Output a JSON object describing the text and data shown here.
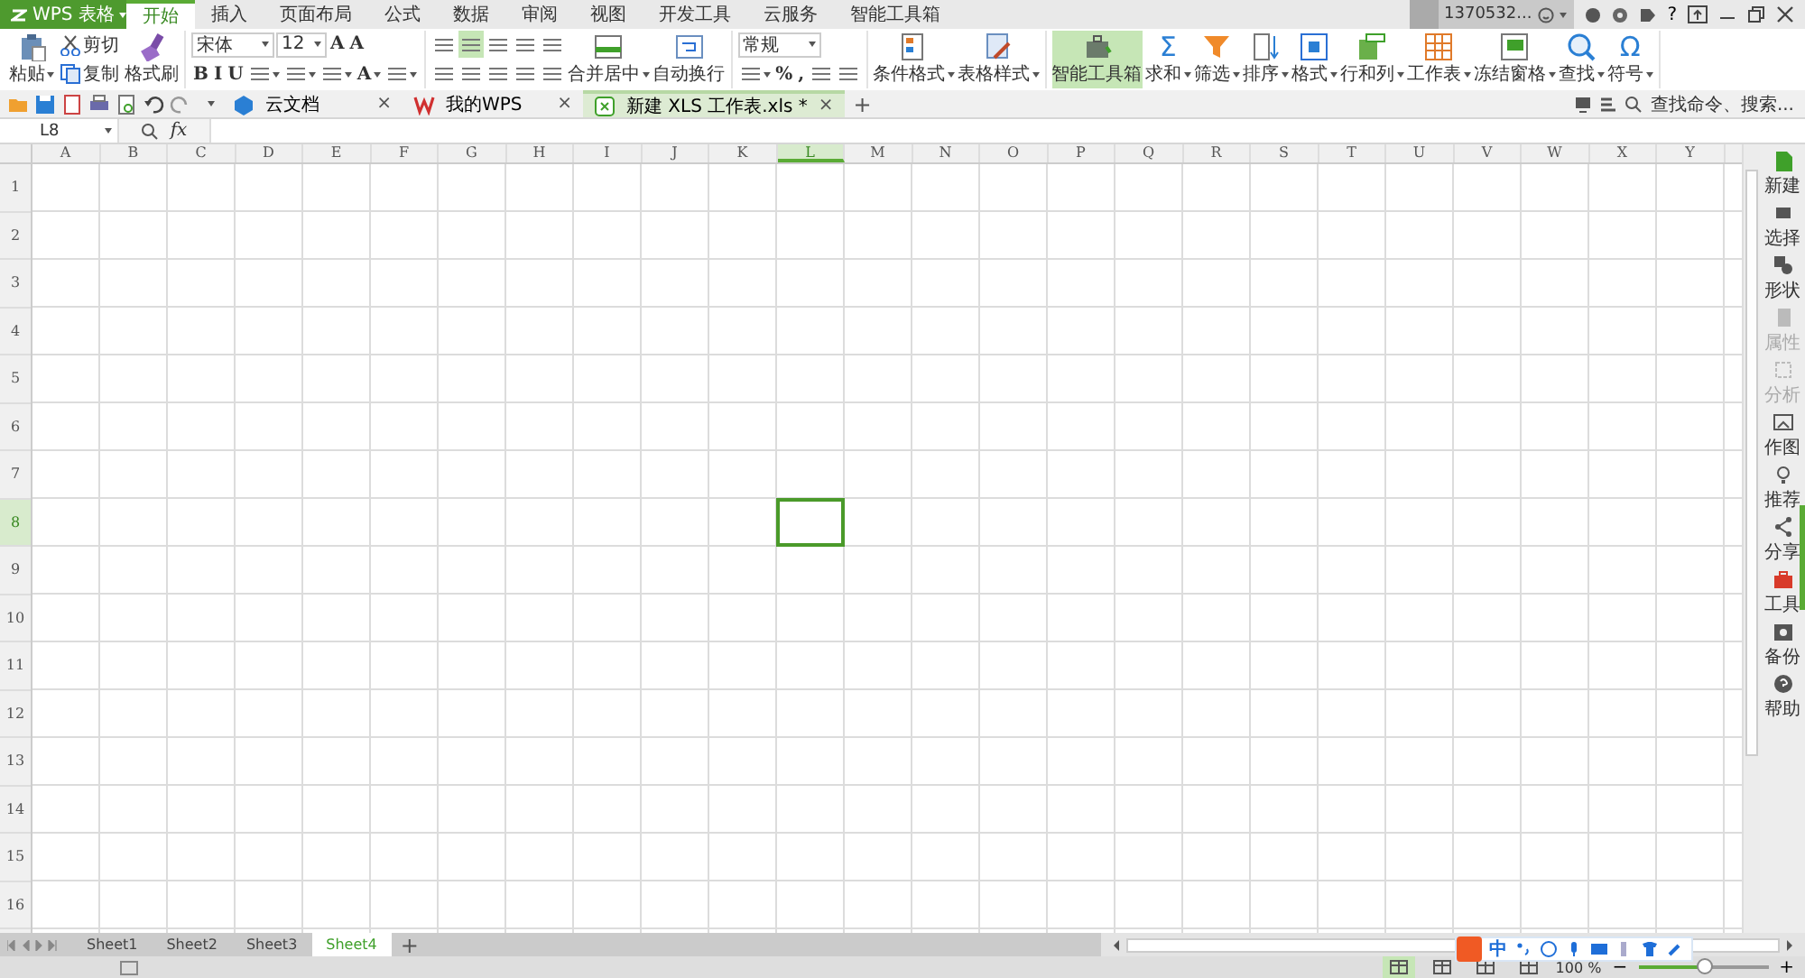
{
  "app_button": {
    "label": "WPS 表格",
    "dropdown": true
  },
  "menu_tabs": [
    {
      "label": "开始",
      "selected": true
    },
    {
      "label": "插入",
      "selected": false
    },
    {
      "label": "页面布局",
      "selected": false
    },
    {
      "label": "公式",
      "selected": false
    },
    {
      "label": "数据",
      "selected": false
    },
    {
      "label": "审阅",
      "selected": false
    },
    {
      "label": "视图",
      "selected": false
    },
    {
      "label": "开发工具",
      "selected": false
    },
    {
      "label": "云服务",
      "selected": false
    },
    {
      "label": "智能工具箱",
      "selected": false
    }
  ],
  "account": {
    "user": "1370532...",
    "help": "?"
  },
  "ribbon": {
    "groups": [
      {
        "items": [
          {
            "kind": "large",
            "label": "粘贴",
            "dropdown": true
          },
          {
            "kind": "stack",
            "lines": [
              {
                "tools": [
                  {
                    "kind": "tool",
                    "label": "剪切"
                  }
                ]
              },
              {
                "tools": [
                  {
                    "kind": "tool",
                    "label": "复制"
                  }
                ]
              }
            ]
          },
          {
            "kind": "large",
            "label": "格式刷"
          }
        ]
      },
      {
        "items": [
          {
            "kind": "stack",
            "lines": [
              {
                "tools": [
                  {
                    "kind": "field",
                    "value": "宋体"
                  },
                  {
                    "kind": "field",
                    "value": "12"
                  },
                  {
                    "kind": "tool",
                    "text": "A"
                  },
                  {
                    "kind": "tool",
                    "text": "A"
                  }
                ]
              },
              {
                "tools": [
                  {
                    "kind": "tool",
                    "text": "B"
                  },
                  {
                    "kind": "tool",
                    "text": "I"
                  },
                  {
                    "kind": "tool",
                    "text": "U"
                  },
                  {
                    "kind": "tool",
                    "dropdown": true
                  },
                  {
                    "kind": "tool",
                    "dropdown": true
                  },
                  {
                    "kind": "tool",
                    "dropdown": true
                  },
                  {
                    "kind": "tool",
                    "text": "A",
                    "dropdown": true
                  },
                  {
                    "kind": "tool",
                    "dropdown": true
                  }
                ]
              }
            ]
          }
        ]
      },
      {
        "items": [
          {
            "kind": "stack",
            "lines": [
              {
                "tools": [
                  {
                    "kind": "tool",
                    "selected": false
                  },
                  {
                    "kind": "tool",
                    "selected": true
                  },
                  {
                    "kind": "tool",
                    "selected": false
                  },
                  {
                    "kind": "tool",
                    "selected": false
                  },
                  {
                    "kind": "tool",
                    "selected": false
                  }
                ]
              },
              {
                "tools": [
                  {
                    "kind": "tool",
                    "selected": false
                  },
                  {
                    "kind": "tool",
                    "selected": false
                  },
                  {
                    "kind": "tool",
                    "selected": false
                  },
                  {
                    "kind": "tool",
                    "selected": false
                  },
                  {
                    "kind": "tool",
                    "selected": false
                  }
                ]
              }
            ]
          },
          {
            "kind": "large",
            "label": "合并居中",
            "dropdown": true
          },
          {
            "kind": "large",
            "label": "自动换行"
          }
        ]
      },
      {
        "items": [
          {
            "kind": "stack",
            "lines": [
              {
                "tools": [
                  {
                    "kind": "field",
                    "value": "常规"
                  }
                ]
              },
              {
                "tools": [
                  {
                    "kind": "tool",
                    "dropdown": true
                  },
                  {
                    "kind": "tool",
                    "text": "%"
                  },
                  {
                    "kind": "tool",
                    "text": ","
                  },
                  {
                    "kind": "tool"
                  },
                  {
                    "kind": "tool"
                  }
                ]
              }
            ]
          }
        ]
      },
      {
        "items": [
          {
            "kind": "large",
            "label": "条件格式",
            "dropdown": true
          },
          {
            "kind": "large",
            "label": "表格样式",
            "dropdown": true
          }
        ]
      },
      {
        "items": [
          {
            "kind": "large",
            "label": "智能工具箱",
            "selected": true
          },
          {
            "kind": "large",
            "label": "求和",
            "text": "Σ",
            "dropdown": true
          },
          {
            "kind": "large",
            "label": "筛选",
            "dropdown": true
          },
          {
            "kind": "large",
            "label": "排序",
            "dropdown": true
          },
          {
            "kind": "large",
            "label": "格式",
            "dropdown": true
          },
          {
            "kind": "large",
            "label": "行和列",
            "dropdown": true
          },
          {
            "kind": "large",
            "label": "工作表",
            "dropdown": true
          },
          {
            "kind": "large",
            "label": "冻结窗格",
            "dropdown": true
          },
          {
            "kind": "large",
            "label": "查找",
            "dropdown": true
          },
          {
            "kind": "large",
            "label": "符号",
            "text": "Ω",
            "dropdown": true
          }
        ]
      }
    ]
  },
  "doc_tabs": [
    {
      "label": "云文档",
      "close": "×",
      "selected": false
    },
    {
      "label": "我的WPS",
      "close": "×",
      "selected": false
    },
    {
      "label": "新建 XLS 工作表.xls *",
      "close": "×",
      "selected": true
    }
  ],
  "new_tab": "+",
  "command_search": {
    "placeholder": "查找命令、搜索..."
  },
  "formula_bar": {
    "name_box": "L8",
    "fx": "fx"
  },
  "sheet": {
    "columns": [
      {
        "label": "A",
        "selected": false
      },
      {
        "label": "B",
        "selected": false
      },
      {
        "label": "C",
        "selected": false
      },
      {
        "label": "D",
        "selected": false
      },
      {
        "label": "E",
        "selected": false
      },
      {
        "label": "F",
        "selected": false
      },
      {
        "label": "G",
        "selected": false
      },
      {
        "label": "H",
        "selected": false
      },
      {
        "label": "I",
        "selected": false
      },
      {
        "label": "J",
        "selected": false
      },
      {
        "label": "K",
        "selected": false
      },
      {
        "label": "L",
        "selected": true
      },
      {
        "label": "M",
        "selected": false
      },
      {
        "label": "N",
        "selected": false
      },
      {
        "label": "O",
        "selected": false
      },
      {
        "label": "P",
        "selected": false
      },
      {
        "label": "Q",
        "selected": false
      },
      {
        "label": "R",
        "selected": false
      },
      {
        "label": "S",
        "selected": false
      },
      {
        "label": "T",
        "selected": false
      },
      {
        "label": "U",
        "selected": false
      },
      {
        "label": "V",
        "selected": false
      },
      {
        "label": "W",
        "selected": false
      },
      {
        "label": "X",
        "selected": false
      },
      {
        "label": "Y",
        "selected": false
      }
    ],
    "rows": [
      {
        "label": "1",
        "selected": false
      },
      {
        "label": "2",
        "selected": false
      },
      {
        "label": "3",
        "selected": false
      },
      {
        "label": "4",
        "selected": false
      },
      {
        "label": "5",
        "selected": false
      },
      {
        "label": "6",
        "selected": false
      },
      {
        "label": "7",
        "selected": false
      },
      {
        "label": "8",
        "selected": true
      },
      {
        "label": "9",
        "selected": false
      },
      {
        "label": "10",
        "selected": false
      },
      {
        "label": "11",
        "selected": false
      },
      {
        "label": "12",
        "selected": false
      },
      {
        "label": "13",
        "selected": false
      },
      {
        "label": "14",
        "selected": false
      },
      {
        "label": "15",
        "selected": false
      },
      {
        "label": "16",
        "selected": false
      }
    ]
  },
  "sheet_tabs": [
    {
      "label": "Sheet1",
      "selected": false
    },
    {
      "label": "Sheet2",
      "selected": false
    },
    {
      "label": "Sheet3",
      "selected": false
    },
    {
      "label": "Sheet4",
      "selected": true
    }
  ],
  "add_sheet": "+",
  "sidebar": [
    {
      "label": "新建",
      "disabled": false
    },
    {
      "label": "选择",
      "disabled": false
    },
    {
      "label": "形状",
      "disabled": false
    },
    {
      "label": "属性",
      "disabled": true
    },
    {
      "label": "分析",
      "disabled": true
    },
    {
      "label": "作图",
      "disabled": false
    },
    {
      "label": "推荐",
      "disabled": false
    },
    {
      "label": "分享",
      "disabled": false
    },
    {
      "label": "工具",
      "disabled": false
    },
    {
      "label": "备份",
      "disabled": false
    },
    {
      "label": "帮助",
      "disabled": false
    }
  ],
  "ime_bar": {
    "mode": "中"
  },
  "status_bar": {
    "views": [
      {
        "selected": true
      },
      {
        "selected": false
      },
      {
        "selected": false
      },
      {
        "selected": false
      }
    ],
    "zoom": "100 %",
    "zoom_out": "−",
    "zoom_in": "+",
    "zoom_slider": {
      "level": 0.5
    }
  }
}
